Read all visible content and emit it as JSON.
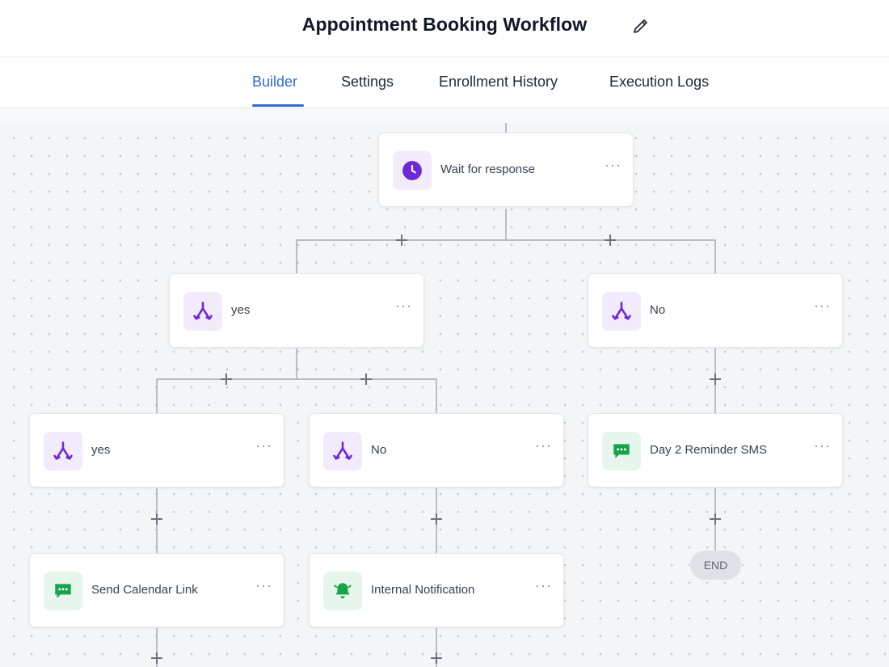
{
  "header": {
    "title": "Appointment Booking Workflow",
    "edit_icon": "pencil-icon"
  },
  "tabs": [
    {
      "label": "Builder",
      "active": true
    },
    {
      "label": "Settings",
      "active": false
    },
    {
      "label": "Enrollment History",
      "active": false
    },
    {
      "label": "Execution Logs",
      "active": false
    }
  ],
  "colors": {
    "accent": "#2f6bd8",
    "purple": "#6d28d9",
    "green": "#16a34a"
  },
  "nodes": [
    {
      "label": "Wait for response",
      "icon": "clock-icon",
      "more": "···"
    },
    {
      "label": "yes",
      "icon": "branch-icon",
      "more": "···"
    },
    {
      "label": "No",
      "icon": "branch-icon",
      "more": "···"
    },
    {
      "label": "yes",
      "icon": "branch-icon",
      "more": "···"
    },
    {
      "label": "No",
      "icon": "branch-icon",
      "more": "···"
    },
    {
      "label": "Day 2 Reminder SMS",
      "icon": "sms-icon",
      "more": "···"
    },
    {
      "label": "Send Calendar Link",
      "icon": "sms-icon",
      "more": "···"
    },
    {
      "label": "Internal Notification",
      "icon": "bell-icon",
      "more": "···"
    }
  ],
  "end_label": "END"
}
